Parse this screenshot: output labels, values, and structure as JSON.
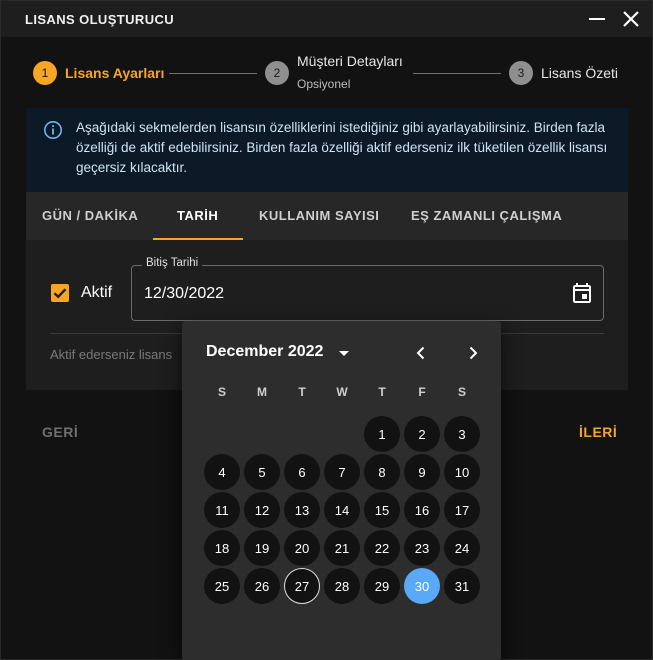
{
  "window": {
    "title": "LISANS OLUŞTURUCU"
  },
  "stepper": {
    "steps": [
      {
        "number": "1",
        "label": "Lisans Ayarları",
        "sub": ""
      },
      {
        "number": "2",
        "label": "Müşteri Detayları",
        "sub": "Opsiyonel"
      },
      {
        "number": "3",
        "label": "Lisans Özeti",
        "sub": ""
      }
    ]
  },
  "alert": {
    "text": "Aşağıdaki sekmelerden lisansın özelliklerini istediğiniz gibi ayarlayabilirsiniz. Birden fazla özelliği de aktif edebilirsiniz. Birden fazla özelliği aktif ederseniz ilk tüketilen özellik lisansı geçersiz kılacaktır."
  },
  "tabs": [
    "GÜN / DAKİKA",
    "TARİH",
    "KULLANIM SAYISI",
    "EŞ ZAMANLI ÇALIŞMA"
  ],
  "active_tab": "TARİH",
  "form": {
    "checkbox_label": "Aktif",
    "checked": true,
    "date_field_label": "Bitiş Tarihi",
    "date_value": "12/30/2022",
    "helper_text": "Aktif ederseniz lisans"
  },
  "footer": {
    "back_label": "GERİ",
    "next_label": "İLERİ"
  },
  "datepicker": {
    "month_label": "December 2022",
    "weekdays": [
      "S",
      "M",
      "T",
      "W",
      "T",
      "F",
      "S"
    ],
    "days": [
      "1",
      "2",
      "3",
      "4",
      "5",
      "6",
      "7",
      "8",
      "9",
      "10",
      "11",
      "12",
      "13",
      "14",
      "15",
      "16",
      "17",
      "18",
      "19",
      "20",
      "21",
      "22",
      "23",
      "24",
      "25",
      "26",
      "27",
      "28",
      "29",
      "30",
      "31"
    ],
    "first_weekday_index": 4,
    "today": "27",
    "selected": "30"
  },
  "colors": {
    "accent": "#f5a623",
    "selected_day": "#5aa9f8",
    "info_icon": "#6fb3f0"
  },
  "icons": {
    "minimize": "minimize-icon",
    "close": "close-icon",
    "info": "info-icon",
    "calendar": "calendar-icon",
    "dropdown": "arrow-drop-down-icon",
    "prev": "chevron-left-icon",
    "next": "chevron-right-icon"
  }
}
